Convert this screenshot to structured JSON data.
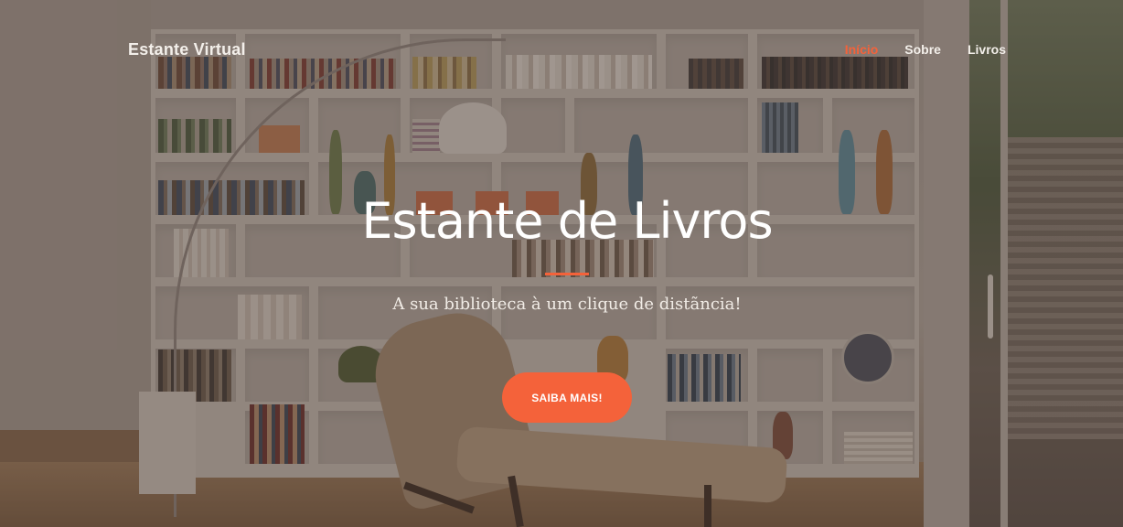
{
  "navbar": {
    "brand": "Estante Virtual",
    "links": [
      {
        "label": "Início",
        "active": true
      },
      {
        "label": "Sobre",
        "active": false
      },
      {
        "label": "Livros",
        "active": false
      }
    ]
  },
  "hero": {
    "title": "Estante de Livros",
    "subtitle": "A sua biblioteca à um clique de distãncia!",
    "cta_label": "SAIBA MAIS!"
  },
  "theme": {
    "accent": "#f4623a",
    "text": "#ffffff"
  }
}
